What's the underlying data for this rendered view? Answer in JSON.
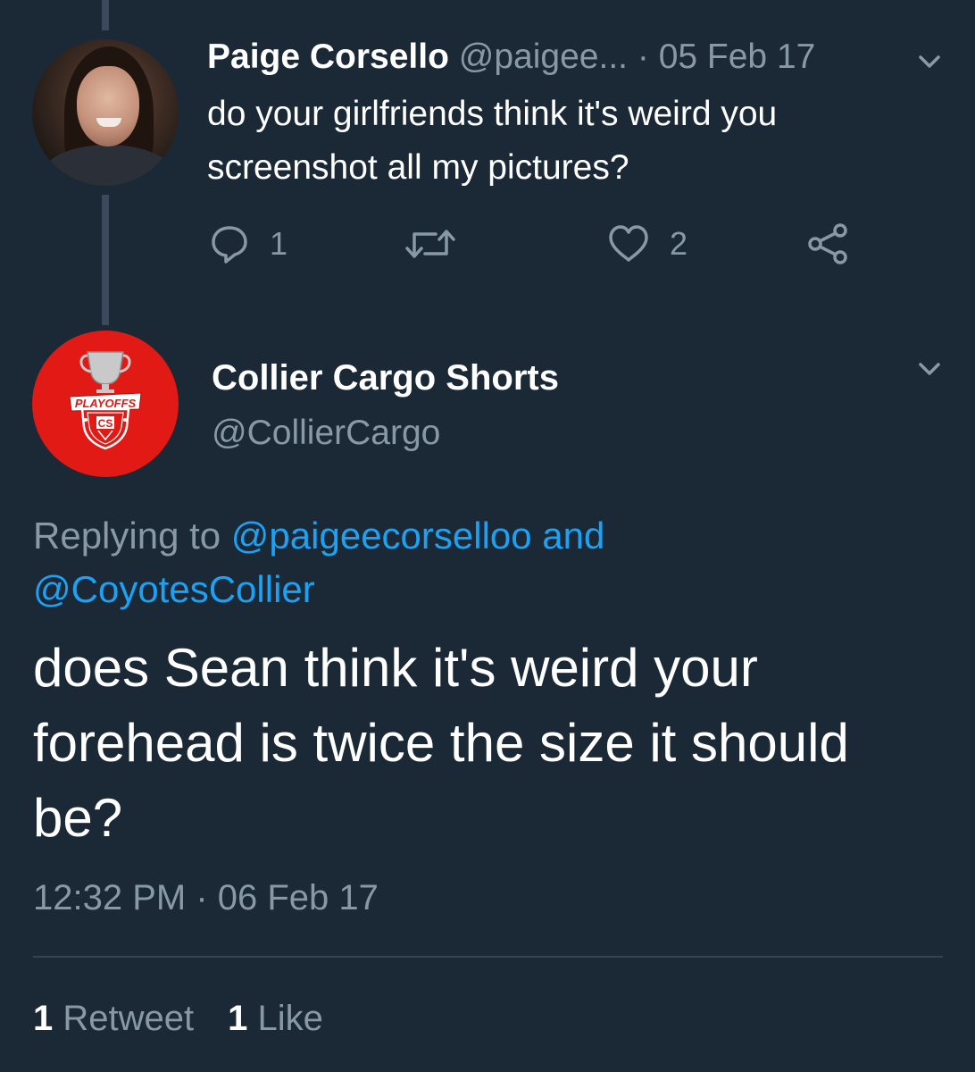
{
  "parent_tweet": {
    "author_name": "Paige Corsello",
    "author_handle": "@paigee...",
    "separator": "·",
    "date": "05 Feb 17",
    "text": "do your girlfriends think it's weird you screenshot all my pictures?",
    "reply_count": "1",
    "retweet_count": "",
    "like_count": "2",
    "icons": [
      "reply-icon",
      "retweet-icon",
      "like-icon",
      "share-icon",
      "chevron-down-icon"
    ]
  },
  "main_tweet": {
    "author_name": "Collier Cargo Shorts",
    "author_handle": "@CollierCargo",
    "avatar_badge": {
      "top_text": "PLAYOFFS",
      "bottom_text": "CS"
    },
    "replying_prefix": "Replying to ",
    "replying_mention_1": "@paigeecorselloo",
    "replying_and": " and",
    "replying_mention_2": "@CoyotesCollier",
    "text": "does Sean think it's weird your forehead is twice the size it should be?",
    "timestamp": "12:32 PM · 06 Feb 17",
    "retweets_count": "1",
    "retweets_label": "Retweet",
    "likes_count": "1",
    "likes_label": "Like"
  },
  "colors": {
    "background": "#1b2836",
    "secondary_text": "#8899a6",
    "link": "#1da1f2",
    "avatar_red": "#e11a16"
  }
}
